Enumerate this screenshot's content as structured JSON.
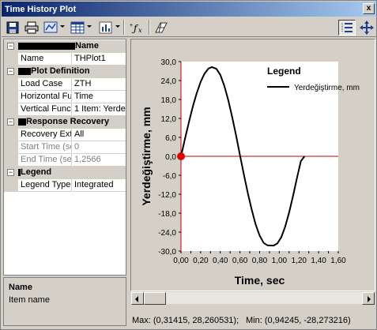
{
  "window": {
    "title": "Time History Plot",
    "close_glyph": "x"
  },
  "toolbar": {
    "buttons": [
      {
        "name": "save-icon"
      },
      {
        "name": "print-icon"
      },
      {
        "name": "chart-view-icon"
      },
      {
        "name": "table-view-icon"
      },
      {
        "name": "bar-chart-icon"
      },
      {
        "name": "function-icon",
        "label": "fx"
      },
      {
        "name": "grid-ruler-icon"
      },
      {
        "name": "property-grid-toggle-icon"
      },
      {
        "name": "pan-move-icon"
      }
    ]
  },
  "property_grid": {
    "categories": [
      {
        "label": "Name",
        "redacted": true,
        "expander": "−",
        "rows": [
          {
            "name": "Name",
            "value": "THPlot1",
            "disabled": false
          }
        ]
      },
      {
        "label": "Plot Definition",
        "redacted": true,
        "expander": "−",
        "rows": [
          {
            "name": "Load Case",
            "value": "ZTH",
            "disabled": false
          },
          {
            "name": "Horizontal Fu",
            "value": "Time",
            "disabled": false
          },
          {
            "name": "Vertical Func",
            "value": "1 Item: Yerdeğ",
            "disabled": false
          }
        ]
      },
      {
        "label": "Response Recovery",
        "redacted": true,
        "expander": "−",
        "rows": [
          {
            "name": "Recovery Ext",
            "value": "All",
            "disabled": false
          },
          {
            "name": "Start Time (se",
            "value": "0",
            "disabled": true
          },
          {
            "name": "End Time (se",
            "value": "1,2566",
            "disabled": true
          }
        ]
      },
      {
        "label": "Legend",
        "redacted": true,
        "expander": "−",
        "rows": [
          {
            "name": "Legend Type",
            "value": "Integrated",
            "disabled": false
          }
        ]
      }
    ]
  },
  "description": {
    "title": "Name",
    "text": "Item name"
  },
  "chart_data": {
    "type": "line",
    "xlabel": "Time,  sec",
    "ylabel": "Yerdeğiştirme,  mm",
    "xlim": [
      0,
      1.6
    ],
    "ylim": [
      -30,
      30
    ],
    "xticks": [
      0.0,
      0.1,
      0.2,
      0.3,
      0.4,
      0.5,
      0.6,
      0.7,
      0.8,
      0.9,
      1.0,
      1.1,
      1.2,
      1.3,
      1.4,
      1.5,
      1.6
    ],
    "xtick_labels": [
      "0,00",
      "0,10",
      "0,20",
      "0,30",
      "0,40",
      "0,50",
      "0,60",
      "0,70",
      "0,80",
      "0,90",
      "1,00",
      "1,10",
      "1,20",
      "1,30",
      "1,40",
      "1,50",
      "1,60"
    ],
    "yticks": [
      30,
      24,
      18,
      12,
      6,
      0,
      -6,
      -12,
      -18,
      -24,
      -30
    ],
    "ytick_labels": [
      "30,0",
      "24,0",
      "18,0",
      "12,0",
      "6,0",
      "0,0",
      "-6,0",
      "-12,0",
      "-18,0",
      "-24,0",
      "-30,0"
    ],
    "legend": {
      "title": "Legend",
      "placement": "top-right"
    },
    "series": [
      {
        "name": "Yerdeğiştirme, mm",
        "color": "#000000",
        "x": [
          0.0,
          0.04,
          0.08,
          0.12,
          0.16,
          0.2,
          0.24,
          0.28,
          0.31415,
          0.36,
          0.4,
          0.44,
          0.48,
          0.52,
          0.56,
          0.6,
          0.64,
          0.68,
          0.72,
          0.76,
          0.8,
          0.84,
          0.88,
          0.94245,
          0.98,
          1.02,
          1.06,
          1.1,
          1.14,
          1.18,
          1.22,
          1.2566
        ],
        "y": [
          0.0,
          5.5,
          10.8,
          15.7,
          20.0,
          23.6,
          26.2,
          27.8,
          28.26,
          27.7,
          25.8,
          22.4,
          17.9,
          12.5,
          6.6,
          0.4,
          -5.8,
          -11.7,
          -17.0,
          -21.6,
          -25.1,
          -27.4,
          -28.2,
          -28.27,
          -27.6,
          -25.6,
          -22.3,
          -17.8,
          -12.5,
          -6.8,
          -1.5,
          0.0
        ]
      }
    ],
    "marker": {
      "x": 0.0,
      "y": 0.0,
      "color": "#e00000"
    },
    "zero_line_color": "#c00000",
    "axis_color": "#c00000",
    "plot_background": "#ffffff"
  },
  "status": {
    "max_text": "Max: (0,31415, 28,260531);",
    "min_text": "Min: (0,94245, -28,273216)"
  }
}
